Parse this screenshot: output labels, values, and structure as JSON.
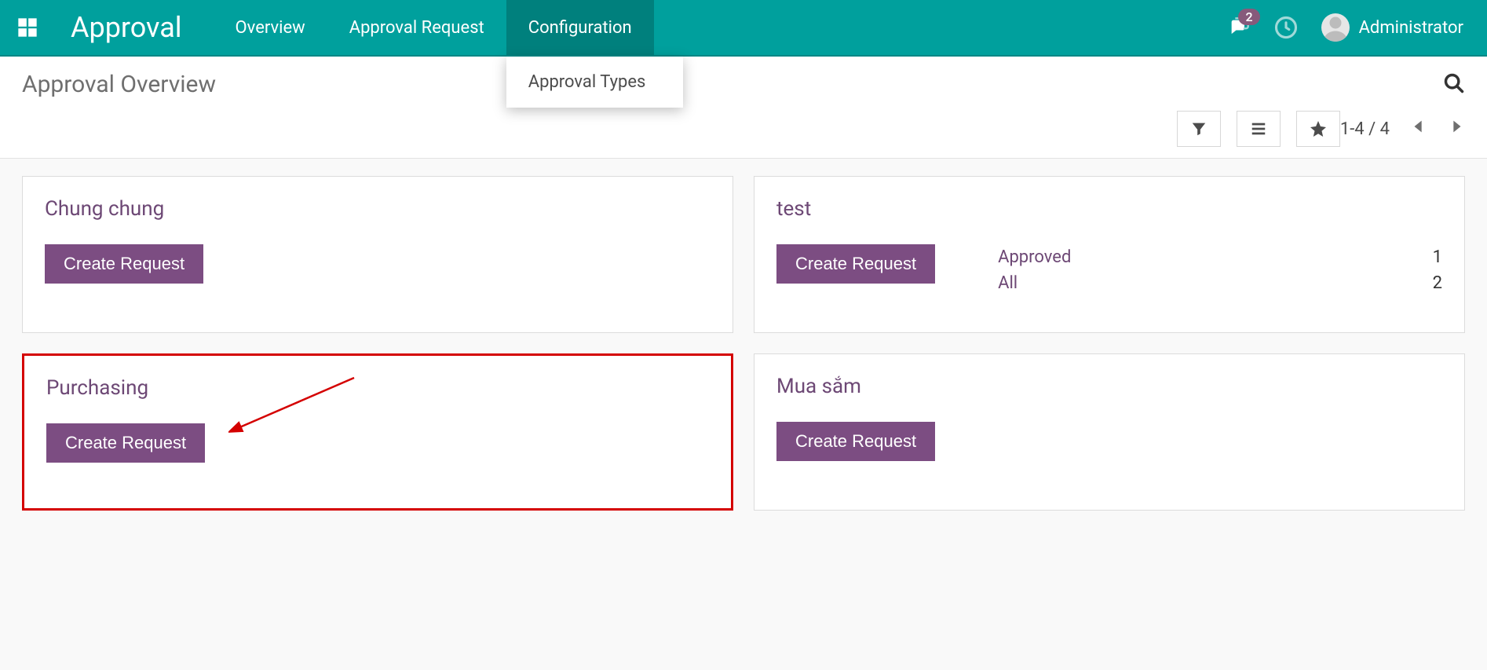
{
  "nav": {
    "brand": "Approval",
    "items": {
      "overview": "Overview",
      "approval_request": "Approval Request",
      "configuration": "Configuration"
    },
    "dropdown": {
      "approval_types": "Approval Types"
    },
    "msg_badge": "2",
    "user_name": "Administrator"
  },
  "page": {
    "title": "Approval Overview",
    "pager": "1-4 / 4"
  },
  "cards": [
    {
      "title": "Chung chung",
      "button": "Create Request",
      "stats": []
    },
    {
      "title": "test",
      "button": "Create Request",
      "stats": [
        {
          "label": "Approved",
          "value": "1"
        },
        {
          "label": "All",
          "value": "2"
        }
      ]
    },
    {
      "title": "Purchasing",
      "button": "Create Request",
      "stats": []
    },
    {
      "title": "Mua sắm",
      "button": "Create Request",
      "stats": []
    }
  ]
}
